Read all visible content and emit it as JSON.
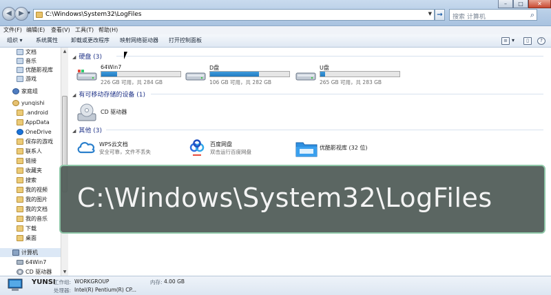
{
  "address_bar": {
    "path": "C:\\Windows\\System32\\LogFiles",
    "search_placeholder": "搜索 计算机"
  },
  "menu": [
    {
      "label": "文件(F)"
    },
    {
      "label": "编辑(E)"
    },
    {
      "label": "查看(V)"
    },
    {
      "label": "工具(T)"
    },
    {
      "label": "帮助(H)"
    }
  ],
  "toolbar": {
    "organize": "组织 ▾",
    "system_properties": "系统属性",
    "uninstall": "卸载或更改程序",
    "map_drive": "映射网络驱动器",
    "control_panel": "打开控制面板"
  },
  "sidebar": {
    "items": [
      {
        "label": "文档"
      },
      {
        "label": "音乐"
      },
      {
        "label": "优酷影视库"
      },
      {
        "label": "游戏"
      },
      {
        "label": "家庭组"
      },
      {
        "label": "yunqishi"
      },
      {
        "label": ".android"
      },
      {
        "label": "AppData"
      },
      {
        "label": "OneDrive"
      },
      {
        "label": "保存的游戏"
      },
      {
        "label": "联系人"
      },
      {
        "label": "链接"
      },
      {
        "label": "收藏夹"
      },
      {
        "label": "搜索"
      },
      {
        "label": "我的视频"
      },
      {
        "label": "我的图片"
      },
      {
        "label": "我的文档"
      },
      {
        "label": "我的音乐"
      },
      {
        "label": "下载"
      },
      {
        "label": "桌面"
      },
      {
        "label": "计算机"
      },
      {
        "label": "64Win7"
      },
      {
        "label": "CD 驱动器"
      }
    ]
  },
  "groups": {
    "hard_disks": "硬盘 (3)",
    "removable": "有可移动存储的设备 (1)",
    "other": "其他 (3)"
  },
  "drives": [
    {
      "name": "64Win7",
      "space": "226 GB 可用，共 284 GB",
      "used_fraction": 0.2
    },
    {
      "name": "D盘",
      "space": "106 GB 可用，共 282 GB",
      "used_fraction": 0.62
    },
    {
      "name": "U盘",
      "space": "265 GB 可用，共 283 GB",
      "used_fraction": 0.06
    }
  ],
  "cd_drive": {
    "name": "CD 驱动器"
  },
  "others": [
    {
      "name": "WPS云文档",
      "desc": "安全可靠，文件不丢失"
    },
    {
      "name": "百度网盘",
      "desc": "双击运行百度网盘"
    },
    {
      "name": "优酷影视库 (32 位)",
      "desc": ""
    }
  ],
  "overlay": {
    "text": "C:\\Windows\\System32\\LogFiles"
  },
  "details": {
    "computer_name": "YUNSI",
    "workgroup_label": "工作组:",
    "workgroup_value": "WORKGROUP",
    "memory_label": "内存:",
    "memory_value": "4.00 GB",
    "processor_label": "处理器:",
    "processor_value": "Intel(R) Pentium(R) CP..."
  },
  "colors": {
    "accent": "#2a7fcc",
    "group_header": "#1e3287",
    "overlay_bg": "#525e5a",
    "overlay_border": "#8ec7a8"
  }
}
